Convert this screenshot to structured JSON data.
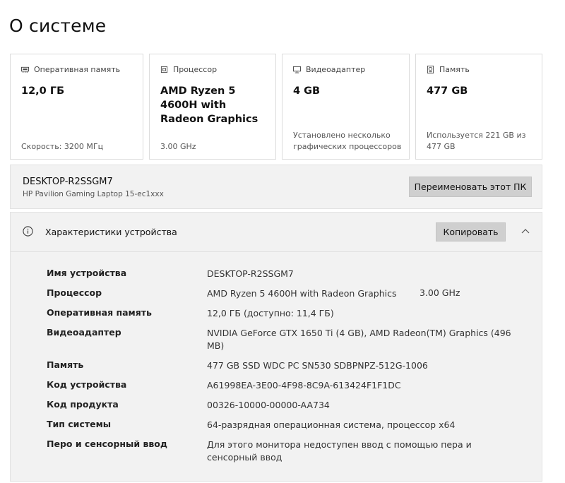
{
  "page": {
    "title": "О системе"
  },
  "cards": [
    {
      "icon": "ram-icon",
      "label": "Оперативная память",
      "value": "12,0 ГБ",
      "footer": "Скорость: 3200 МГц"
    },
    {
      "icon": "processor-icon",
      "label": "Процессор",
      "value": "AMD Ryzen 5 4600H with Radeon Graphics",
      "footer": "3.00 GHz"
    },
    {
      "icon": "monitor-icon",
      "label": "Видеоадаптер",
      "value": "4 GB",
      "footer": "Установлено несколько графических процессоров"
    },
    {
      "icon": "storage-icon",
      "label": "Память",
      "value": "477 GB",
      "footer": "Используется 221 GB из 477 GB"
    }
  ],
  "device": {
    "name": "DESKTOP-R2SSGM7",
    "model": "HP Pavilion Gaming Laptop 15-ec1xxx",
    "rename_label": "Переименовать этот ПК"
  },
  "specs": {
    "title": "Характеристики устройства",
    "copy_label": "Копировать",
    "rows": [
      {
        "label": "Имя устройства",
        "value": "DESKTOP-R2SSGM7"
      },
      {
        "label": "Процессор",
        "value": "AMD Ryzen 5 4600H with Radeon Graphics",
        "extra": "3.00 GHz"
      },
      {
        "label": "Оперативная память",
        "value": "12,0 ГБ (доступно: 11,4 ГБ)"
      },
      {
        "label": "Видеоадаптер",
        "value": "NVIDIA GeForce GTX 1650 Ti (4 GB), AMD Radeon(TM) Graphics (496 MB)"
      },
      {
        "label": "Память",
        "value": "477 GB SSD WDC PC SN530 SDBPNPZ-512G-1006"
      },
      {
        "label": "Код устройства",
        "value": "A61998EA-3E00-4F98-8C9A-613424F1F1DC"
      },
      {
        "label": "Код продукта",
        "value": "00326-10000-00000-AA734"
      },
      {
        "label": "Тип системы",
        "value": "64-разрядная операционная система, процессор x64"
      },
      {
        "label": "Перо и сенсорный ввод",
        "value": "Для этого монитора недоступен ввод с помощью пера и сенсорный ввод"
      }
    ]
  }
}
